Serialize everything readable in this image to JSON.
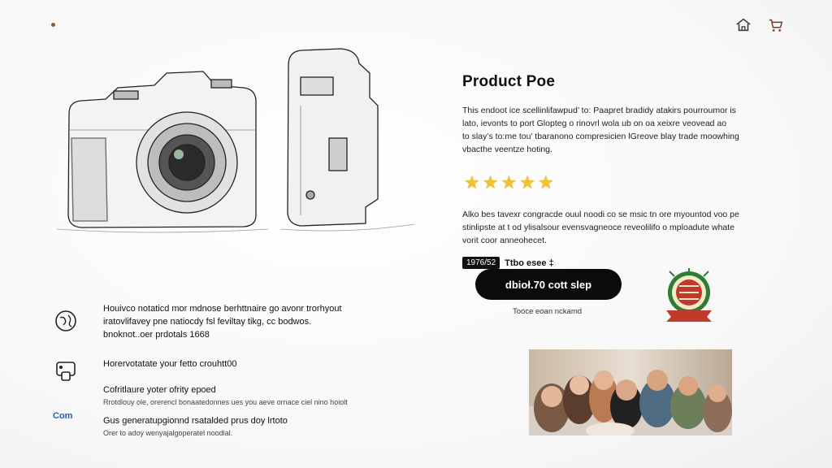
{
  "header": {
    "icons": [
      "home-icon",
      "cart-icon"
    ]
  },
  "product": {
    "title": "Product Poe",
    "description": [
      "This endoot ice scellinlifawpud’ to: Paapret bradidy atakirs pourroumor is",
      "lato, ievonts to port Glopteg o rinovrl wola ub on oa xeixre veovead ao",
      "to slay’s to:me tou’ tbaranono compresicien lGreove blay trade moowhing",
      "vbacthe veentze hoting."
    ],
    "rating": 5,
    "description2": [
      "Alko bes tavexr congracde ouul noodi co se msic tn ore myountod voo pe",
      "stinlipste at t od ylisalsour evensvagneoce reveolilifo o mploadute whate",
      "vorit coor anneohecet."
    ],
    "price_badge": "1976/52",
    "price_text": "Ttbo esee ‡",
    "cta_label": "dbioł.70 cott slep",
    "cta_subtext": "Tooce eoan nckamd"
  },
  "features": [
    {
      "icon": "globe-icon",
      "lines": [
        "Houivco notaticd mor mdnose berhttnaire go avonr trorhyout",
        "iratovlifavey pne natiocdy fsl feviltay tikg, cc bodwos.",
        "bnoknot..oer prdotals 1668"
      ]
    },
    {
      "icon": "lock-device-icon",
      "lines": [
        "Horervotatate your fetto crouhtt00"
      ]
    },
    {
      "icon": "",
      "lines": [
        "Cofritlaure yoter ofrity epoed",
        "Rrotdlouy ole, orerencl bonaatedonnes ues you aeve ornace ciel nino hoiolt"
      ]
    },
    {
      "icon": "com-logo",
      "logo_text": "Com",
      "lines": [
        "Gus generatupgionnd rsatalded prus doy lrtoto",
        "Orer to adoy wenyajalgoperatel noodlal."
      ]
    }
  ],
  "colors": {
    "star": "#f2c230",
    "cta_bg": "#0b0b0b",
    "seal_green": "#2f7d32",
    "seal_red": "#c0392b"
  }
}
